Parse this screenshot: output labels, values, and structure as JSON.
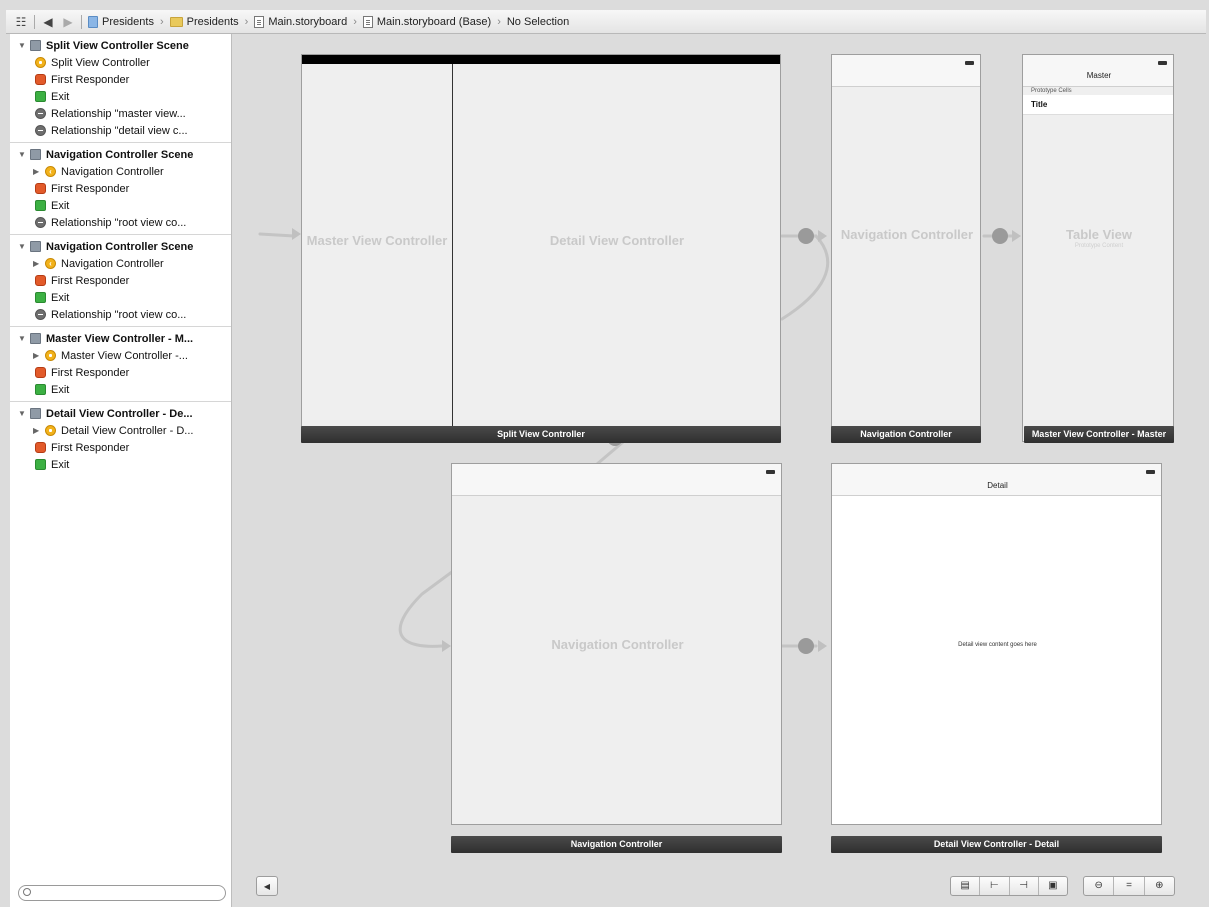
{
  "breadcrumb": {
    "items": [
      "Presidents",
      "Presidents",
      "Main.storyboard",
      "Main.storyboard (Base)",
      "No Selection"
    ]
  },
  "outline": {
    "scenes": [
      {
        "title": "Split View Controller Scene",
        "items": [
          "Split View Controller",
          "First Responder",
          "Exit",
          "Relationship \"master view...",
          "Relationship \"detail view c..."
        ]
      },
      {
        "title": "Navigation Controller Scene",
        "items": [
          "Navigation Controller",
          "First Responder",
          "Exit",
          "Relationship \"root view co..."
        ]
      },
      {
        "title": "Navigation Controller Scene",
        "items": [
          "Navigation Controller",
          "First Responder",
          "Exit",
          "Relationship \"root view co..."
        ]
      },
      {
        "title": "Master View Controller - M...",
        "items": [
          "Master View Controller -...",
          "First Responder",
          "Exit"
        ]
      },
      {
        "title": "Detail View Controller - De...",
        "items": [
          "Detail View Controller - D...",
          "First Responder",
          "Exit"
        ]
      }
    ]
  },
  "canvas": {
    "split": {
      "master_ghost": "Master View Controller",
      "detail_ghost": "Detail View Controller",
      "label": "Split View Controller"
    },
    "nav1": {
      "ghost": "Navigation Controller",
      "label": "Navigation Controller"
    },
    "master": {
      "nav_title": "Master",
      "section": "Prototype Cells",
      "cell": "Title",
      "ghost": "Table View",
      "ghost_sub": "Prototype Content",
      "label": "Master View Controller - Master"
    },
    "nav2": {
      "ghost": "Navigation Controller",
      "label": "Navigation Controller"
    },
    "detail": {
      "nav_title": "Detail",
      "content": "Detail view content goes here",
      "label": "Detail View Controller - Detail"
    }
  },
  "colors": {
    "scene_label": "#333333",
    "segue": "#c0c0c0",
    "ghost_text": "#c9c9c9"
  }
}
